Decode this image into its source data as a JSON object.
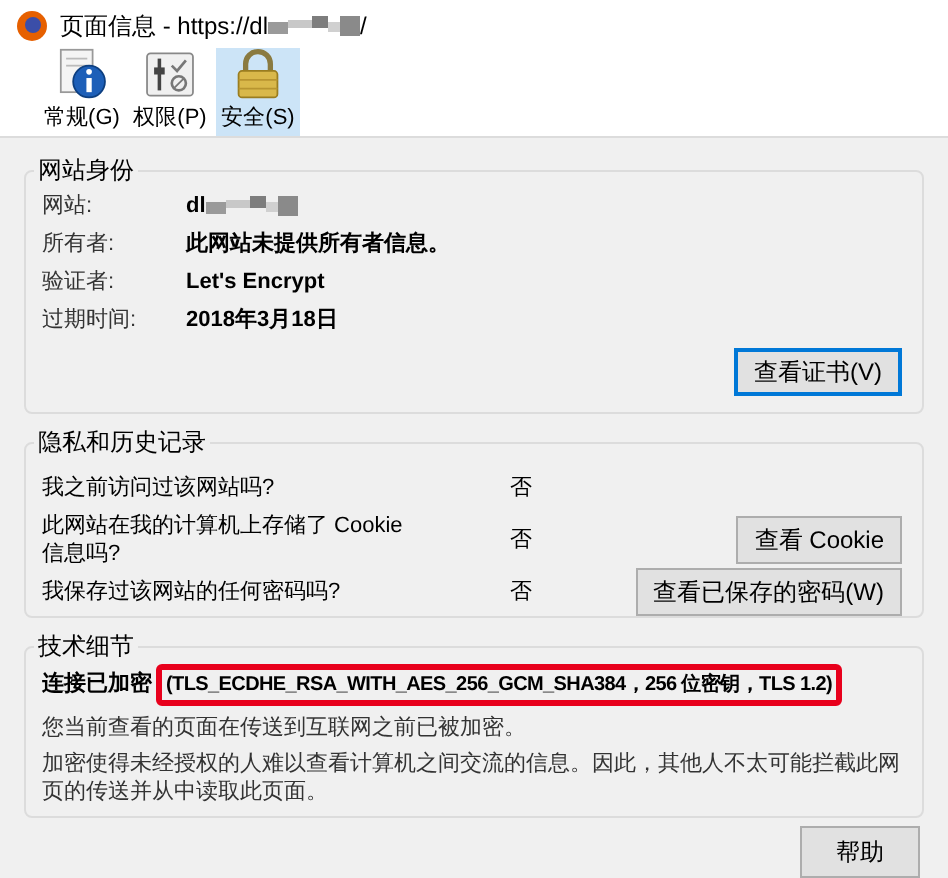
{
  "window": {
    "title": "页面信息 - https://dl",
    "title_end": "/"
  },
  "tabs": [
    {
      "label": "常规(G)",
      "kind": "info",
      "selected": false
    },
    {
      "label": "权限(P)",
      "kind": "permissions",
      "selected": false
    },
    {
      "label": "安全(S)",
      "kind": "lock",
      "selected": true
    }
  ],
  "identity": {
    "title": "网站身份",
    "rows": [
      {
        "label": "网站:",
        "value": "dl",
        "redacted": true
      },
      {
        "label": "所有者:",
        "value": "此网站未提供所有者信息。",
        "redacted": false
      },
      {
        "label": "验证者:",
        "value": "Let's Encrypt",
        "redacted": false
      },
      {
        "label": "过期时间:",
        "value": "2018年3月18日",
        "redacted": false
      }
    ],
    "button": "查看证书(V)"
  },
  "privacy": {
    "title": "隐私和历史记录",
    "rows": [
      {
        "question": "我之前访问过该网站吗?",
        "answer": "否"
      },
      {
        "question": "此网站在我的计算机上存储了 Cookie 信息吗?",
        "answer": "否",
        "button": "查看 Cookie"
      },
      {
        "question": "我保存过该网站的任何密码吗?",
        "answer": "否",
        "button": "查看已保存的密码(W)"
      }
    ]
  },
  "technical": {
    "title": "技术细节",
    "label": "连接已加密",
    "cipher": "(TLS_ECDHE_RSA_WITH_AES_256_GCM_SHA384，256 位密钥，TLS 1.2)",
    "highlighted": true,
    "paragraphs": [
      "您当前查看的页面在传送到互联网之前已被加密。",
      "加密使得未经授权的人难以查看计算机之间交流的信息。因此，其他人不太可能拦截此网页的传送并从中读取此页面。"
    ]
  },
  "help_button": "帮助"
}
